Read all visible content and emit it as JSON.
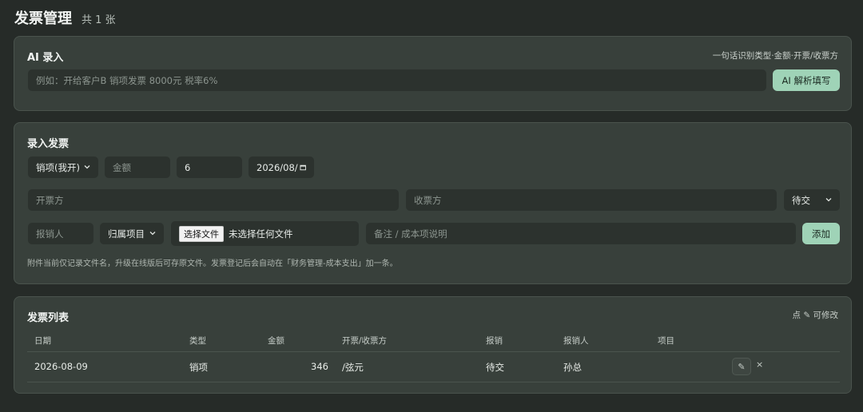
{
  "header": {
    "title": "发票管理",
    "count": "共 1 张"
  },
  "ai_card": {
    "title": "AI 录入",
    "hint": "一句话识别类型·金额·开票/收票方",
    "input_placeholder": "例如：开给客户B 销项发票 8000元 税率6%",
    "parse_button": "AI 解析填写"
  },
  "entry_card": {
    "title": "录入发票",
    "type_select": "销项(我开)",
    "amount_placeholder": "金额",
    "tax_rate_value": "6",
    "date_value": "2026/08/",
    "issuer_placeholder": "开票方",
    "receiver_placeholder": "收票方",
    "status_select": "待交",
    "reimburser_placeholder": "报销人",
    "project_select": "归属项目",
    "file_button": "选择文件",
    "file_status": "未选择任何文件",
    "remark_placeholder": "备注 / 成本项说明",
    "add_button": "添加",
    "note": "附件当前仅记录文件名，升级在线版后可存原文件。发票登记后会自动在「财务管理-成本支出」加一条。"
  },
  "list_card": {
    "title": "发票列表",
    "hint": "点 ✎ 可修改",
    "columns": [
      "日期",
      "类型",
      "金额",
      "开票/收票方",
      "报销",
      "报销人",
      "项目"
    ],
    "rows": [
      {
        "date": "2026-08-09",
        "type": "销项",
        "amount": "346",
        "party": "/弦元",
        "reimburse": "待交",
        "reimburser": "孙总",
        "project": ""
      }
    ],
    "edit_icon": "✎",
    "delete_icon": "×"
  },
  "colors": {
    "accent": "#9fd3b7",
    "background": "#262b28",
    "card": "#38403b",
    "field": "#2c322e"
  },
  "icons": [
    "chevron-down-icon",
    "calendar-icon",
    "edit-icon",
    "close-icon"
  ]
}
